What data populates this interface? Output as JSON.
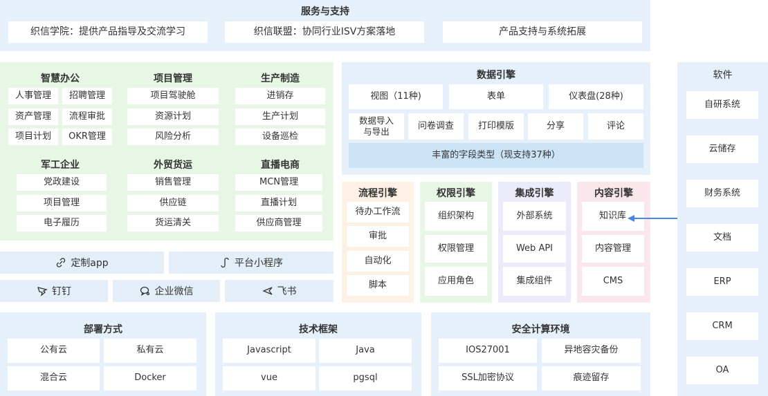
{
  "services": {
    "title": "服务与支持",
    "items": [
      "织信学院：提供产品指导及交流学习",
      "织信联盟：协同行业ISV方案落地",
      "产品支持与系统拓展"
    ]
  },
  "apps": {
    "groups": [
      {
        "title": "智慧办公",
        "items": [
          "人事管理",
          "招聘管理",
          "资产管理",
          "流程审批",
          "项目计划",
          "OKR管理"
        ]
      },
      {
        "title": "项目管理",
        "items": [
          "项目驾驶舱",
          "资源计划",
          "风险分析"
        ]
      },
      {
        "title": "生产制造",
        "items": [
          "进销存",
          "生产计划",
          "设备巡检"
        ]
      },
      {
        "title": "军工企业",
        "items": [
          "党政建设",
          "项目管理",
          "电子履历"
        ]
      },
      {
        "title": "外贸货运",
        "items": [
          "销售管理",
          "供应链",
          "货运清关"
        ]
      },
      {
        "title": "直播电商",
        "items": [
          "MCN管理",
          "直播计划",
          "供应商管理"
        ]
      }
    ]
  },
  "channels": {
    "custom_app": "定制app",
    "mini_program": "平台小程序",
    "dingtalk": "钉钉",
    "wecom": "企业微信",
    "feishu": "飞书"
  },
  "data_engine": {
    "title": "数据引擎",
    "row1": [
      "视图（11种)",
      "表单",
      "仪表盘(28种)"
    ],
    "row2": [
      "数据导入\n与导出",
      "问卷调查",
      "打印模版",
      "分享",
      "评论"
    ],
    "field_types": "丰富的字段类型（现支持37种）"
  },
  "engines": [
    {
      "title": "流程引擎",
      "items": [
        "待办工作流",
        "审批",
        "自动化",
        "脚本"
      ]
    },
    {
      "title": "权限引擎",
      "items": [
        "组织架构",
        "权限管理",
        "应用角色"
      ]
    },
    {
      "title": "集成引擎",
      "items": [
        "外部系统",
        "Web API",
        "集成组件"
      ]
    },
    {
      "title": "内容引擎",
      "items": [
        "知识库",
        "内容管理",
        "CMS"
      ]
    }
  ],
  "software": {
    "title": "软件",
    "items": [
      "自研系统",
      "云储存",
      "财务系统",
      "文档",
      "ERP",
      "CRM",
      "OA"
    ]
  },
  "deploy": {
    "title": "部署方式",
    "items": [
      "公有云",
      "私有云",
      "混合云",
      "Docker"
    ]
  },
  "tech": {
    "title": "技术框架",
    "items": [
      "Javascript",
      "Java",
      "vue",
      "pgsql"
    ]
  },
  "security": {
    "title": "安全计算环境",
    "items": [
      "IOS27001",
      "异地容灾备份",
      "SSL加密协议",
      "痕迹留存"
    ]
  },
  "colors": {
    "blue": "#e6f0fb",
    "green": "#e8f6e6",
    "orange": "#fcf1e4",
    "purple": "#ebebf9",
    "pink": "#f9e7ec",
    "arrow": "#4a86e8"
  }
}
